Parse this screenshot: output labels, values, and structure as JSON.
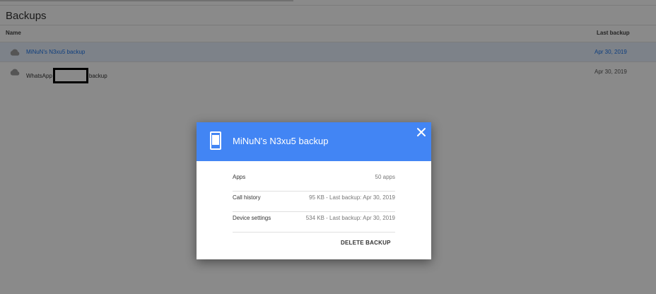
{
  "page": {
    "title": "Backups"
  },
  "table": {
    "columns": {
      "name": "Name",
      "last_backup": "Last backup"
    },
    "rows": [
      {
        "icon": "cloud-icon",
        "name": "MiNuN's N3xu5 backup",
        "date": "Apr 30, 2019",
        "selected": true
      },
      {
        "icon": "cloud-icon",
        "name_prefix": "WhatsApp",
        "name_suffix": "backup",
        "date": "Apr 30, 2019",
        "redacted": true
      }
    ]
  },
  "dialog": {
    "icon": "phone-icon",
    "title": "MiNuN's N3xu5 backup",
    "close_icon": "close-icon",
    "items": [
      {
        "label": "Apps",
        "value": "50 apps"
      },
      {
        "label": "Call history",
        "value": "95 KB - Last backup: Apr 30, 2019"
      },
      {
        "label": "Device settings",
        "value": "534 KB - Last backup: Apr 30, 2019"
      }
    ],
    "delete_label": "DELETE BACKUP"
  },
  "colors": {
    "accent": "#4285f4",
    "selected_row": "#e8f0fe",
    "selected_text": "#1a73e8"
  }
}
